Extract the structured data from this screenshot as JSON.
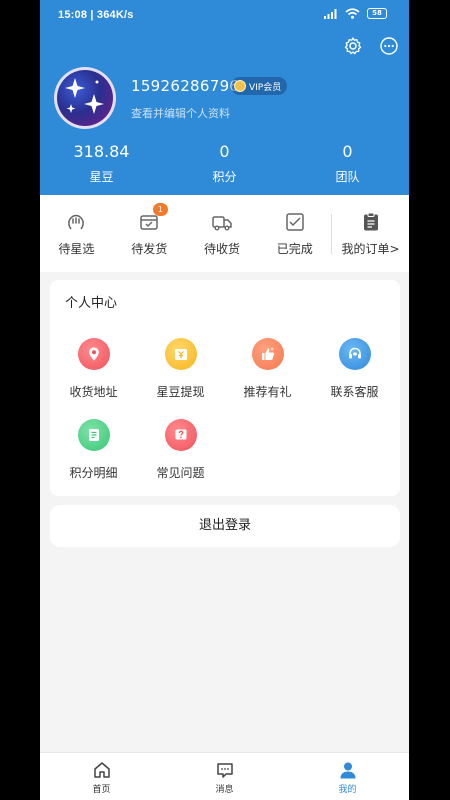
{
  "status_bar": {
    "time": "15:08 | 364K/s",
    "battery": "58"
  },
  "profile": {
    "phone": "15926286796",
    "vip_label": "VIP会员",
    "edit_hint": "查看并编辑个人资料"
  },
  "stats": [
    {
      "value": "318.84",
      "label": "星豆"
    },
    {
      "value": "0",
      "label": "积分"
    },
    {
      "value": "0",
      "label": "团队"
    }
  ],
  "orders": {
    "items": [
      {
        "label": "待星选",
        "icon": "hand-icon"
      },
      {
        "label": "待发货",
        "icon": "package-icon",
        "badge": "1"
      },
      {
        "label": "待收货",
        "icon": "truck-icon"
      },
      {
        "label": "已完成",
        "icon": "done-icon"
      }
    ],
    "my_orders": "我的订单>"
  },
  "personal_center": {
    "title": "个人中心",
    "items": [
      {
        "label": "收货地址",
        "icon": "location-icon",
        "color": "#f0525a"
      },
      {
        "label": "星豆提现",
        "icon": "wallet-icon",
        "color": "#f6b41c"
      },
      {
        "label": "推荐有礼",
        "icon": "thumbs-up-icon",
        "color": "#f57950"
      },
      {
        "label": "联系客服",
        "icon": "headset-icon",
        "color": "#2f8ad8"
      },
      {
        "label": "积分明细",
        "icon": "list-icon",
        "color": "#39c777"
      },
      {
        "label": "常见问题",
        "icon": "question-icon",
        "color": "#f0525a"
      }
    ]
  },
  "logout_label": "退出登录",
  "tabbar": [
    {
      "label": "首页",
      "icon": "home-icon",
      "active": false
    },
    {
      "label": "消息",
      "icon": "message-icon",
      "active": false
    },
    {
      "label": "我的",
      "icon": "user-icon",
      "active": true
    }
  ],
  "colors": {
    "primary": "#2f8ad8",
    "badge": "#f27a2b",
    "background": "#f4f4f4"
  }
}
